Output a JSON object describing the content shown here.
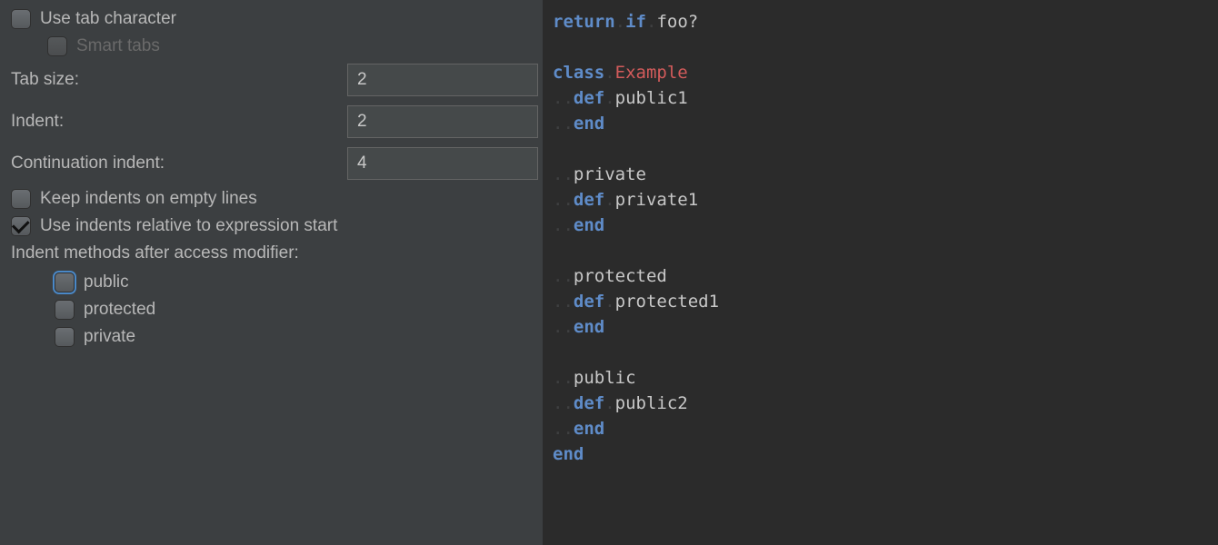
{
  "settings": {
    "use_tab_character": {
      "label": "Use tab character",
      "checked": false
    },
    "smart_tabs": {
      "label": "Smart tabs",
      "checked": false,
      "disabled": true
    },
    "tab_size": {
      "label": "Tab size:",
      "value": "2"
    },
    "indent": {
      "label": "Indent:",
      "value": "2"
    },
    "continuation_indent": {
      "label": "Continuation indent:",
      "value": "4"
    },
    "keep_indents_empty": {
      "label": "Keep indents on empty lines",
      "checked": false
    },
    "relative_indents": {
      "label": "Use indents relative to expression start",
      "checked": true
    },
    "indent_after_modifier_label": "Indent methods after access modifier:",
    "modifiers": {
      "public": {
        "label": "public",
        "checked": false,
        "focused": true
      },
      "protected": {
        "label": "protected",
        "checked": false
      },
      "private": {
        "label": "private",
        "checked": false
      }
    }
  },
  "preview": {
    "lines": [
      [
        {
          "t": "return",
          "c": "kw"
        },
        {
          "t": ".",
          "c": "ws"
        },
        {
          "t": "if",
          "c": "kw"
        },
        {
          "t": ".",
          "c": "ws"
        },
        {
          "t": "foo?",
          "c": "ident"
        }
      ],
      [],
      [
        {
          "t": "class",
          "c": "kw"
        },
        {
          "t": ".",
          "c": "ws"
        },
        {
          "t": "Example",
          "c": "cls"
        }
      ],
      [
        {
          "t": "..",
          "c": "ws"
        },
        {
          "t": "def",
          "c": "kw"
        },
        {
          "t": ".",
          "c": "ws"
        },
        {
          "t": "public1",
          "c": "ident"
        }
      ],
      [
        {
          "t": "..",
          "c": "ws"
        },
        {
          "t": "end",
          "c": "kw"
        }
      ],
      [],
      [
        {
          "t": "..",
          "c": "ws"
        },
        {
          "t": "private",
          "c": "ident"
        }
      ],
      [
        {
          "t": "..",
          "c": "ws"
        },
        {
          "t": "def",
          "c": "kw"
        },
        {
          "t": ".",
          "c": "ws"
        },
        {
          "t": "private1",
          "c": "ident"
        }
      ],
      [
        {
          "t": "..",
          "c": "ws"
        },
        {
          "t": "end",
          "c": "kw"
        }
      ],
      [],
      [
        {
          "t": "..",
          "c": "ws"
        },
        {
          "t": "protected",
          "c": "ident"
        }
      ],
      [
        {
          "t": "..",
          "c": "ws"
        },
        {
          "t": "def",
          "c": "kw"
        },
        {
          "t": ".",
          "c": "ws"
        },
        {
          "t": "protected1",
          "c": "ident"
        }
      ],
      [
        {
          "t": "..",
          "c": "ws"
        },
        {
          "t": "end",
          "c": "kw"
        }
      ],
      [],
      [
        {
          "t": "..",
          "c": "ws"
        },
        {
          "t": "public",
          "c": "ident"
        }
      ],
      [
        {
          "t": "..",
          "c": "ws"
        },
        {
          "t": "def",
          "c": "kw"
        },
        {
          "t": ".",
          "c": "ws"
        },
        {
          "t": "public2",
          "c": "ident"
        }
      ],
      [
        {
          "t": "..",
          "c": "ws"
        },
        {
          "t": "end",
          "c": "kw"
        }
      ],
      [
        {
          "t": "end",
          "c": "kw"
        }
      ]
    ]
  }
}
